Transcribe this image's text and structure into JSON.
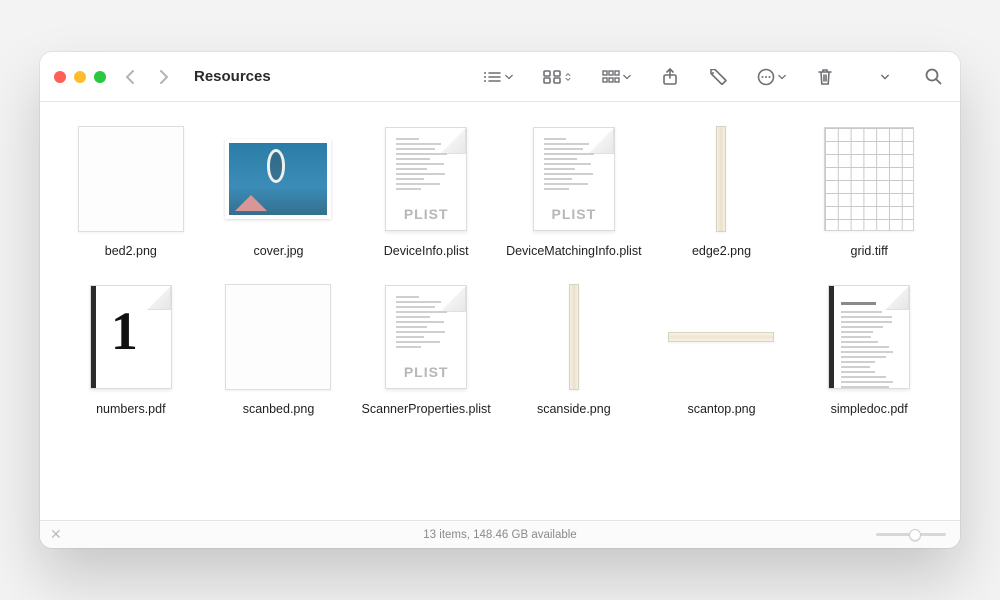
{
  "window": {
    "title": "Resources"
  },
  "files": [
    {
      "name": "bed2.png",
      "kind": "blank"
    },
    {
      "name": "cover.jpg",
      "kind": "photo"
    },
    {
      "name": "DeviceInfo.plist",
      "kind": "plist",
      "badge": "PLIST"
    },
    {
      "name": "DeviceMatchingInfo.plist",
      "kind": "plist",
      "badge": "PLIST"
    },
    {
      "name": "edge2.png",
      "kind": "tallstrip"
    },
    {
      "name": "grid.tiff",
      "kind": "gridpat"
    },
    {
      "name": "numbers.pdf",
      "kind": "pdf-number"
    },
    {
      "name": "scanbed.png",
      "kind": "blank"
    },
    {
      "name": "ScannerProperties.plist",
      "kind": "plist",
      "badge": "PLIST"
    },
    {
      "name": "scanside.png",
      "kind": "tallstrip"
    },
    {
      "name": "scantop.png",
      "kind": "widestrip"
    },
    {
      "name": "simpledoc.pdf",
      "kind": "pdf-text"
    }
  ],
  "status": {
    "text": "13 items, 148.46 GB available",
    "zoom_pct": 55
  }
}
